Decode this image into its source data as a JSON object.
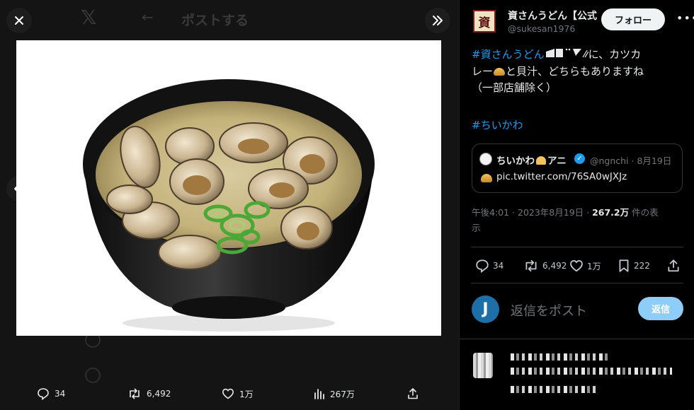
{
  "viewer": {
    "background_heading": "ポストする",
    "actions": {
      "replies": "34",
      "reposts": "6,492",
      "likes": "1万",
      "views": "267万"
    }
  },
  "post": {
    "author_name": "資さんうどん【公式】",
    "author_handle": "@sukesan1976",
    "avatar_glyph": "資",
    "follow_label": "フォロー",
    "text_hashtag": "#資さんうどん",
    "text_line1_suffix": "に、カツカ",
    "text_line2_pre": "レー",
    "text_line2_post": "と貝汁、どちらもありますね",
    "text_line3": "（一部店舗除く）",
    "hashtag2": "#ちいかわ",
    "quote": {
      "name": "ちいかわ",
      "name_suffix": "アニ",
      "meta": "@ngnchi · 8月19日",
      "link": "pic.twitter.com/76SA0wJXJz"
    },
    "timestamp_line": "午後4:01 · 2023年8月19日 · ",
    "views_count": "267.2万",
    "views_suffix": " 件の表",
    "views_suffix2": "示",
    "stats": {
      "replies": "34",
      "reposts": "6,492",
      "likes": "1万",
      "bookmarks": "222"
    }
  },
  "reply": {
    "avatar_letter": "J",
    "placeholder": "返信をポスト",
    "button_label": "返信"
  },
  "colors": {
    "accent": "#1d9bf0",
    "muted": "#71767b",
    "reply_button": "#8ecdf8"
  }
}
